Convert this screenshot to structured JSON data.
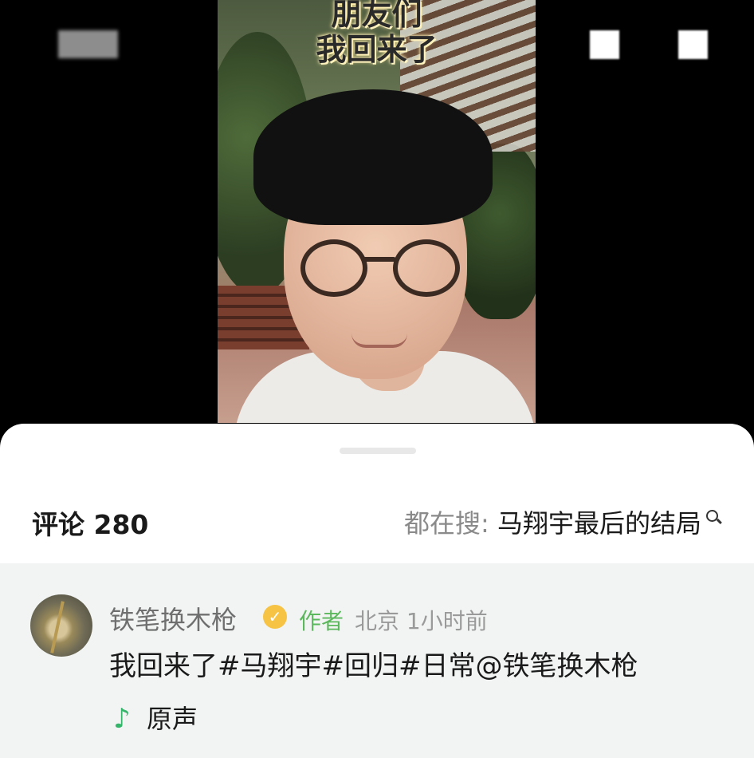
{
  "video": {
    "caption_line1": "朋友们",
    "caption_line2": "我回来了"
  },
  "sheet": {
    "comment_count_label": "评论 280",
    "search_prefix": "都在搜: ",
    "search_term": "马翔宇最后的结局",
    "search_icon": "search-icon"
  },
  "comment": {
    "username": "铁笔换木枪",
    "verified_icon": "verified-badge-icon",
    "author_tag": "作者",
    "meta": "北京 1小时前",
    "text": "我回来了#马翔宇#回归#日常@铁笔换木枪",
    "music_icon": "♪",
    "music_label": "原声"
  },
  "colors": {
    "author_tag": "#5cb85c",
    "music_icon": "#35b56a",
    "verified": "#f6c344"
  }
}
